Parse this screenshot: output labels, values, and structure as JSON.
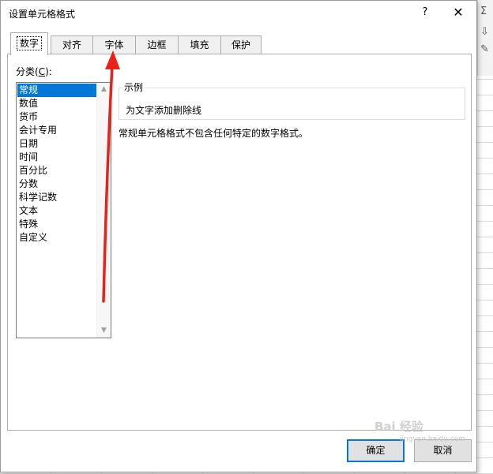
{
  "dialog": {
    "title": "设置单元格格式",
    "help_symbol": "?",
    "close_symbol": "✕"
  },
  "tabs": [
    {
      "label": "数字",
      "active": true
    },
    {
      "label": "对齐",
      "active": false
    },
    {
      "label": "字体",
      "active": false
    },
    {
      "label": "边框",
      "active": false
    },
    {
      "label": "填充",
      "active": false
    },
    {
      "label": "保护",
      "active": false
    }
  ],
  "category": {
    "label_prefix": "分类(",
    "label_key": "C",
    "label_suffix": "):",
    "items": [
      "常规",
      "数值",
      "货币",
      "会计专用",
      "日期",
      "时间",
      "百分比",
      "分数",
      "科学记数",
      "文本",
      "特殊",
      "自定义"
    ],
    "selected": "常规"
  },
  "sample": {
    "legend": "示例",
    "text": "为文字添加删除线"
  },
  "description": "常规单元格格式不包含任何特定的数字格式。",
  "buttons": {
    "ok": "确定",
    "cancel": "取消"
  },
  "icons": {
    "scroll_up": "chevron-up-icon",
    "scroll_down": "chevron-down-icon",
    "sum": "sigma-icon"
  },
  "annotation": {
    "color": "#e8221b"
  },
  "watermark": {
    "text": "Bai 经验",
    "sub": "jingyan.baidu.com"
  }
}
